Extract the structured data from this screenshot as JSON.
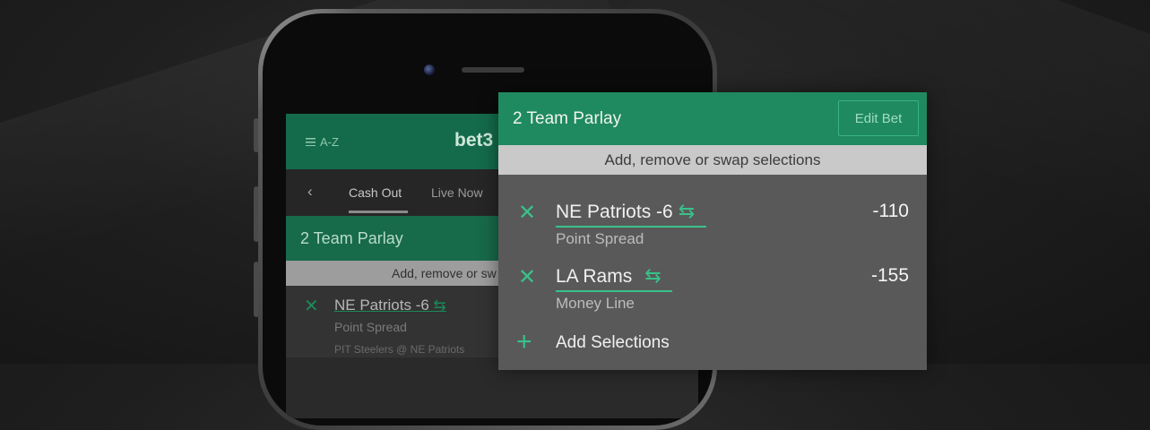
{
  "phone": {
    "header": {
      "menu_label": "A-Z",
      "logo_text": "bet3"
    },
    "nav": {
      "back_glyph": "‹",
      "tabs": [
        {
          "label": "Cash Out"
        },
        {
          "label": "Live Now"
        }
      ]
    },
    "parlay_title": "2 Team Parlay",
    "parlay_subtitle": "Add, remove or sw",
    "selection": {
      "remove_glyph": "✕",
      "team": "NE Patriots -6",
      "swap_glyph": "⇆",
      "type": "Point Spread",
      "match": "PIT Steelers @ NE Patriots"
    }
  },
  "card": {
    "title": "2 Team Parlay",
    "edit_label": "Edit Bet",
    "subtitle": "Add, remove or swap selections",
    "selections": [
      {
        "remove_glyph": "✕",
        "team": "NE Patriots -6",
        "swap_glyph": "⇆",
        "type": "Point Spread",
        "odds": "-110"
      },
      {
        "remove_glyph": "✕",
        "team": "LA Rams",
        "swap_glyph": "⇆",
        "type": "Money Line",
        "odds": "-155"
      }
    ],
    "add": {
      "plus_glyph": "+",
      "label": "Add Selections"
    }
  },
  "colors": {
    "brand_green": "#1f8a5f",
    "accent_green": "#38c28a",
    "panel_gray": "#595959"
  },
  "icons": [
    "hamburger-icon",
    "back-chevron-icon",
    "close-icon",
    "swap-icon",
    "plus-icon",
    "camera-icon"
  ]
}
